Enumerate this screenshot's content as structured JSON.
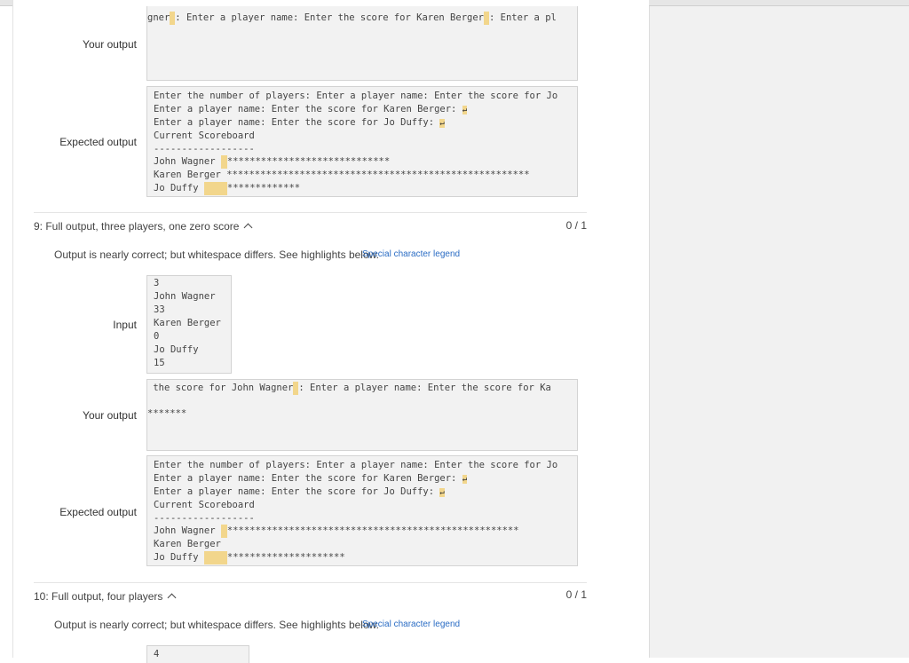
{
  "top_case": {
    "your_output_label": "Your output",
    "your_output_line": {
      "pre": "gner",
      "mid": ": Enter a player name: Enter the score for Karen Berger",
      "post": ": Enter a pl"
    },
    "expected_label": "Expected output",
    "expected_lines": [
      "Enter the number of players: Enter a player name: Enter the score for Jo",
      "Enter a player name: Enter the score for Karen Berger: ",
      "Enter a player name: Enter the score for Jo Duffy: ",
      "Current Scoreboard",
      "------------------",
      "John Wagner ",
      "Karen Berger ",
      "Jo Duffy "
    ],
    "stars": [
      "*****************************",
      "******************************************************",
      "*************"
    ]
  },
  "test9": {
    "header": "9: Full output, three players, one zero score",
    "score": "0 / 1",
    "message": "Output is nearly correct; but whitespace differs. See highlights below.",
    "legend": "Special character legend",
    "input_label": "Input",
    "input_lines": [
      "3",
      "John Wagner",
      "33",
      "Karen Berger",
      "0",
      "Jo Duffy",
      "15"
    ],
    "your_output_label": "Your output",
    "your_output_line1": {
      "pre": " the score for John Wagner",
      "post": ": Enter a player name: Enter the score for Ka"
    },
    "your_output_line2": "*******",
    "expected_label": "Expected output",
    "expected_lines": [
      "Enter the number of players: Enter a player name: Enter the score for Jo",
      "Enter a player name: Enter the score for Karen Berger: ",
      "Enter a player name: Enter the score for Jo Duffy: ",
      "Current Scoreboard",
      "------------------",
      "John Wagner ",
      "Karen Berger",
      "Jo Duffy "
    ],
    "stars": [
      "****************************************************",
      "*********************"
    ]
  },
  "test10": {
    "header": "10: Full output, four players",
    "score": "0 / 1",
    "message": "Output is nearly correct; but whitespace differs. See highlights below.",
    "legend": "Special character legend",
    "input_first": "4"
  },
  "icons": {
    "return": "↵"
  }
}
